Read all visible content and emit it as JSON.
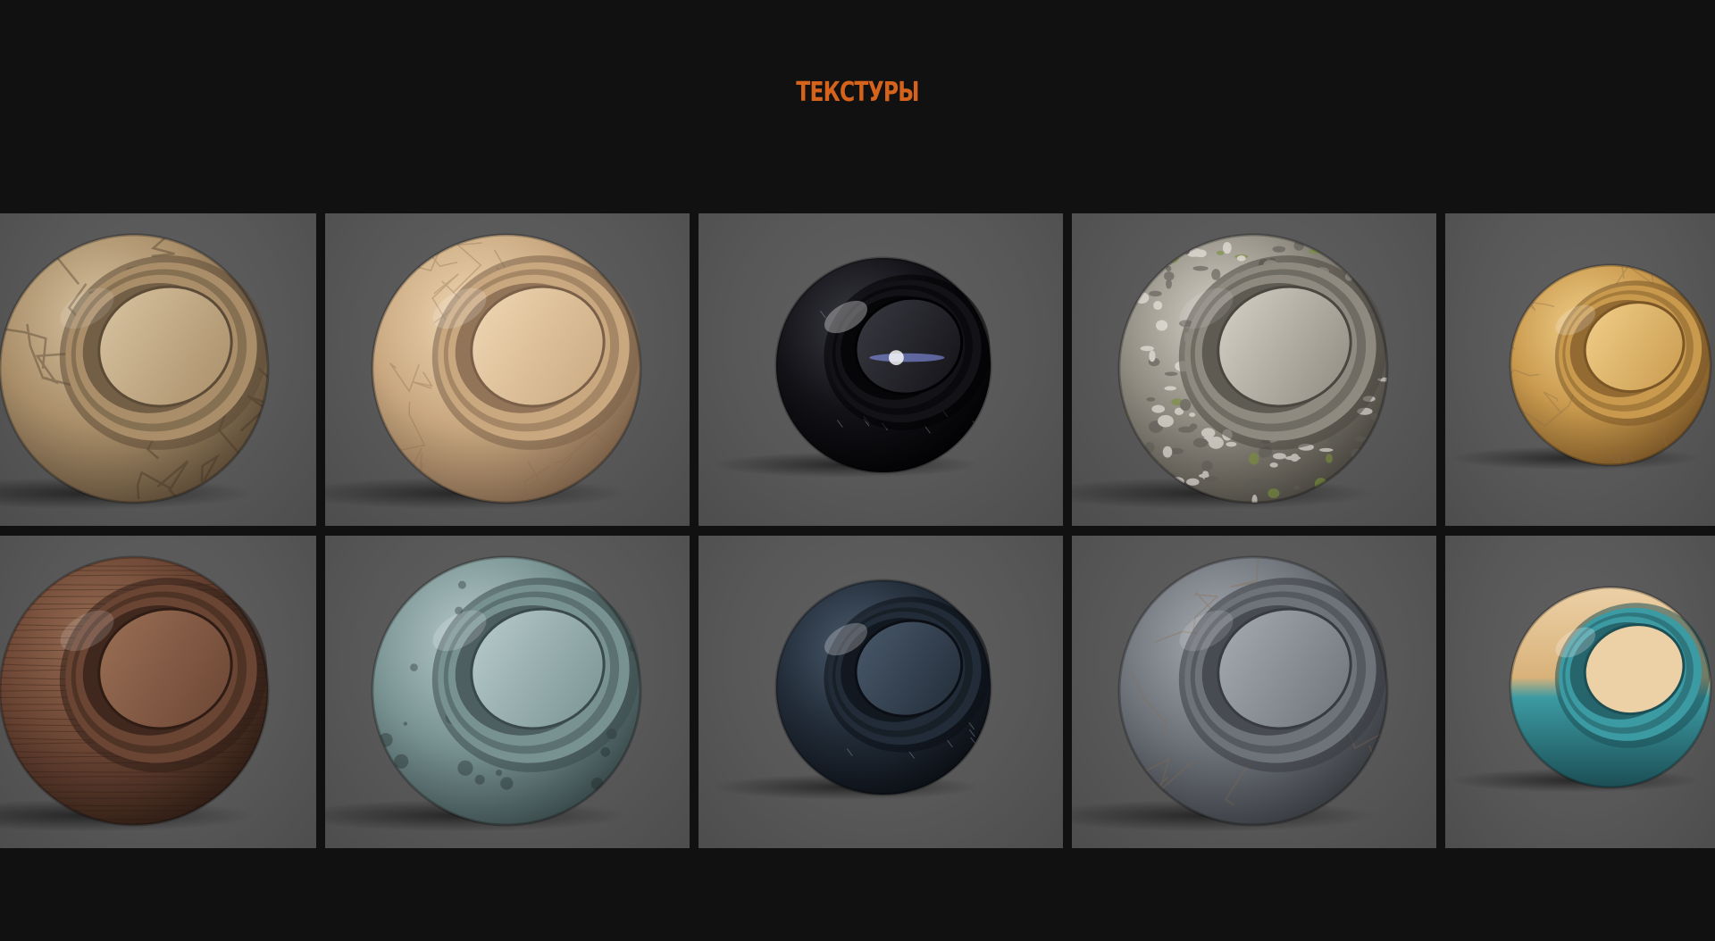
{
  "header": {
    "title": "ТЕКСТУРЫ",
    "title_color": "#d5631b"
  },
  "gallery": {
    "rows": [
      [
        {
          "material": "cracked-sandstone",
          "colors": [
            "#d9c4a1",
            "#a98e69",
            "#5c4b37"
          ],
          "gloss": 0.15,
          "pattern": "cracks"
        },
        {
          "material": "beige-marble",
          "colors": [
            "#f0d8b4",
            "#c9a880",
            "#7a6048"
          ],
          "gloss": 0.35,
          "pattern": "cells"
        },
        {
          "material": "black-glossy-plastic",
          "colors": [
            "#3a3a42",
            "#121217",
            "#020204"
          ],
          "gloss": 1.0,
          "pattern": "scratches"
        },
        {
          "material": "mossy-gravel",
          "colors": [
            "#d6d2c8",
            "#8e8a80",
            "#4a4740"
          ],
          "gloss": 0.1,
          "pattern": "gravel"
        },
        {
          "material": "gold-ochre",
          "colors": [
            "#f2cf8a",
            "#c99a4e",
            "#7a5626"
          ],
          "gloss": 0.45,
          "pattern": "cells"
        }
      ],
      [
        {
          "material": "dark-wood",
          "colors": [
            "#9b7055",
            "#6b4534",
            "#2f1d15"
          ],
          "gloss": 0.3,
          "pattern": "grain"
        },
        {
          "material": "worn-teal-metal",
          "colors": [
            "#b9cccc",
            "#789292",
            "#3a4a4b"
          ],
          "gloss": 0.4,
          "pattern": "stains"
        },
        {
          "material": "dark-navy-metal",
          "colors": [
            "#4a5a6c",
            "#222c38",
            "#0b0f15"
          ],
          "gloss": 0.7,
          "pattern": "scratches"
        },
        {
          "material": "grey-slate",
          "colors": [
            "#a7acb2",
            "#6e737a",
            "#383b40"
          ],
          "gloss": 0.25,
          "pattern": "cells"
        },
        {
          "material": "gold-turquoise-ceramic",
          "colors": [
            "#ecd0a6",
            "#3c9aa2",
            "#1c4e55"
          ],
          "gloss": 0.6,
          "pattern": "split"
        }
      ]
    ]
  }
}
